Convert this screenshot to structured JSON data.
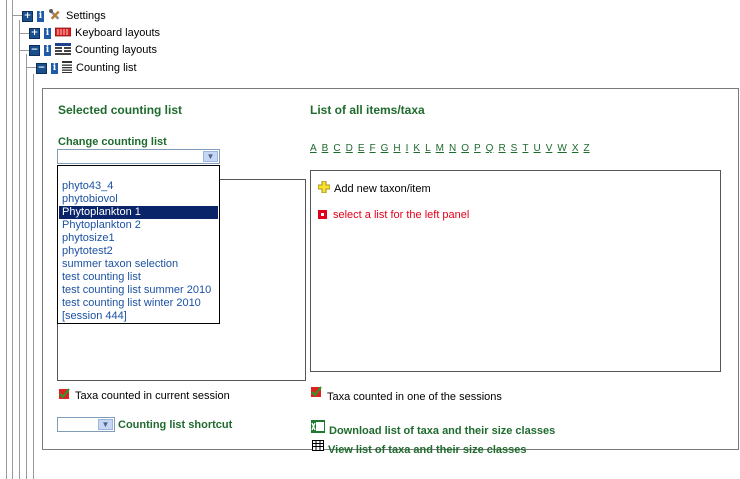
{
  "tree": {
    "settings": "Settings",
    "keyboard_layouts": "Keyboard layouts",
    "counting_layouts": "Counting layouts",
    "counting_list": "Counting list",
    "expand_glyph": "+",
    "collapse_glyph": "−",
    "info_glyph": "i"
  },
  "left": {
    "heading": "Selected counting list",
    "change_label": "Change counting list",
    "select_value": "",
    "options": [
      "",
      "phyto43_4",
      "phytobiovol",
      "Phytoplankton 1",
      "Phytoplankton 2",
      "phytosize1",
      "phytotest2",
      "summer taxon selection",
      "test counting list",
      "test counting list summer 2010",
      "test counting list winter 2010",
      "[session 444]"
    ],
    "selected_option": "Phytoplankton 1",
    "taxa_current_session": "Taxa counted in current session",
    "shortcut_label": "Counting list shortcut",
    "shortcut_value": ""
  },
  "right": {
    "heading": "List of all items/taxa",
    "letters": [
      "A",
      "B",
      "C",
      "D",
      "E",
      "F",
      "G",
      "H",
      "I",
      "K",
      "L",
      "M",
      "N",
      "O",
      "P",
      "Q",
      "R",
      "S",
      "T",
      "U",
      "V",
      "W",
      "X",
      "Z"
    ],
    "add_new": "Add new taxon/item",
    "select_prompt": "select a list for the left panel",
    "taxa_one_session": "Taxa counted in one of the sessions",
    "download_link": "Download list of taxa and their size classes",
    "view_link": "View list of taxa and their size classes"
  },
  "colors": {
    "heading_green": "#1f6b2e",
    "link_blue": "#1c52a3",
    "selection": "#0a246a",
    "error_red": "#e3001b"
  }
}
